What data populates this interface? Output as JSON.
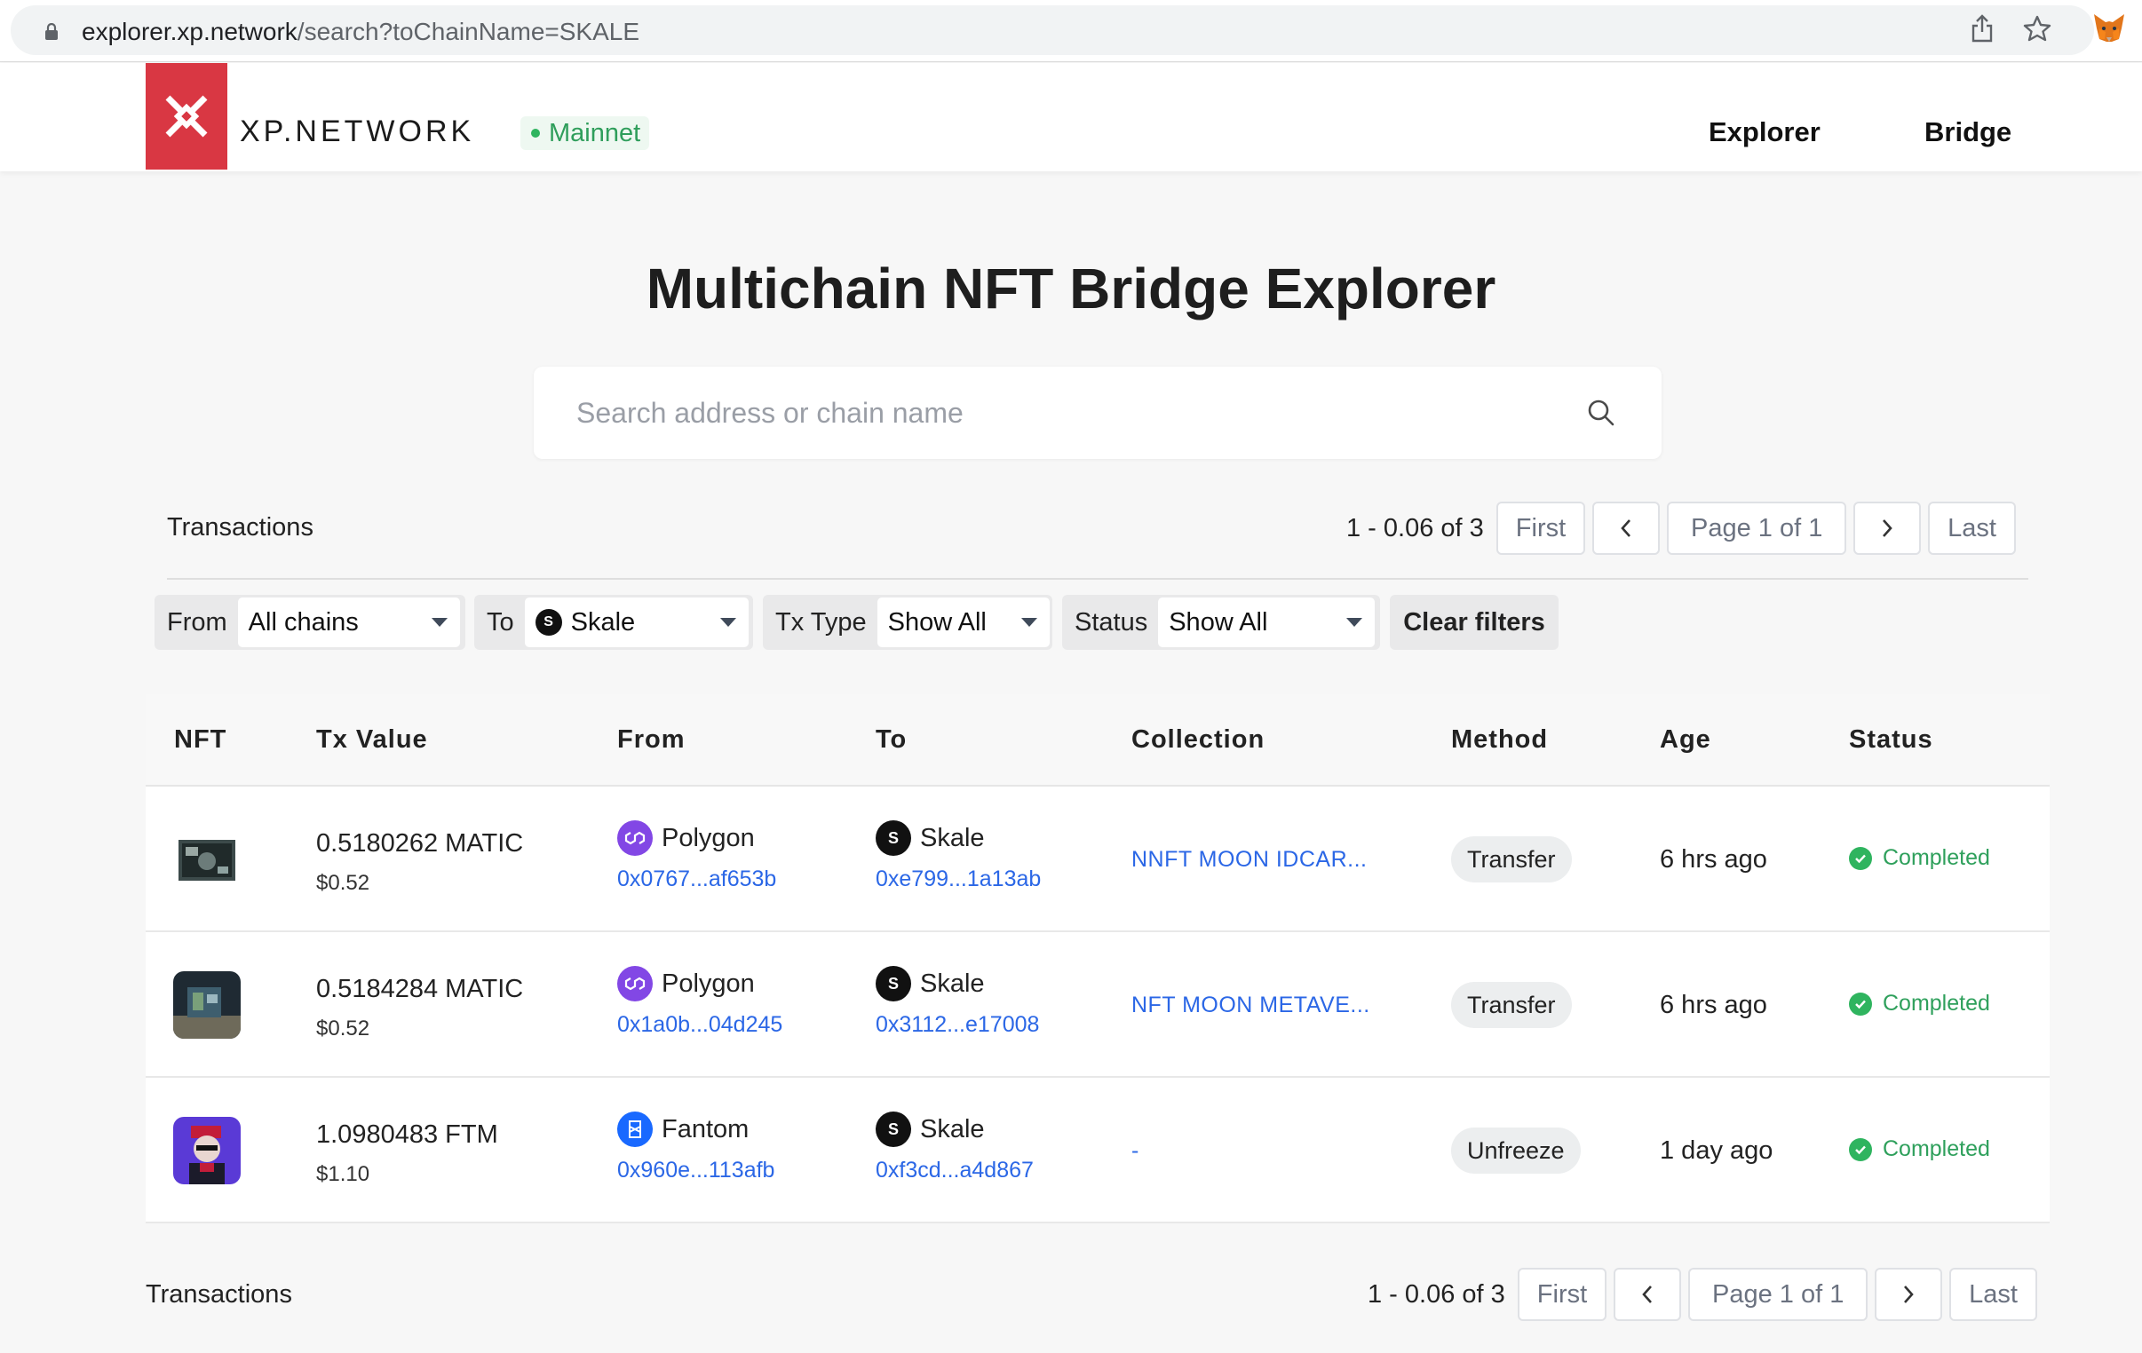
{
  "browser": {
    "url_host": "explorer.xp.network",
    "url_path": "/search?toChainName=SKALE"
  },
  "header": {
    "brand": "XP.NETWORK",
    "network_badge": "Mainnet",
    "nav": {
      "explorer": "Explorer",
      "bridge": "Bridge"
    }
  },
  "page": {
    "title": "Multichain NFT Bridge Explorer",
    "search_placeholder": "Search address or chain name"
  },
  "pagination_top": {
    "label": "Transactions",
    "range": "1 - 0.06 of 3",
    "first": "First",
    "page": "Page 1 of 1",
    "last": "Last"
  },
  "pagination_bottom": {
    "label": "Transactions",
    "range": "1 - 0.06 of 3",
    "first": "First",
    "page": "Page 1 of 1",
    "last": "Last"
  },
  "filters": {
    "from_label": "From",
    "from_value": "All chains",
    "to_label": "To",
    "to_value": "Skale",
    "txtype_label": "Tx Type",
    "txtype_value": "Show All",
    "status_label": "Status",
    "status_value": "Show All",
    "clear": "Clear filters"
  },
  "table": {
    "headers": {
      "nft": "NFT",
      "tx_value": "Tx Value",
      "from": "From",
      "to": "To",
      "collection": "Collection",
      "method": "Method",
      "age": "Age",
      "status": "Status"
    },
    "rows": [
      {
        "value": "0.5180262 MATIC",
        "usd": "$0.52",
        "from_chain": "Polygon",
        "from_addr": "0x0767...af653b",
        "to_chain": "Skale",
        "to_addr": "0xe799...1a13ab",
        "collection": "NNFT MOON IDCAR...",
        "method": "Transfer",
        "age": "6 hrs ago",
        "status": "Completed"
      },
      {
        "value": "0.5184284 MATIC",
        "usd": "$0.52",
        "from_chain": "Polygon",
        "from_addr": "0x1a0b...04d245",
        "to_chain": "Skale",
        "to_addr": "0x3112...e17008",
        "collection": "NFT MOON METAVE...",
        "method": "Transfer",
        "age": "6 hrs ago",
        "status": "Completed"
      },
      {
        "value": "1.0980483 FTM",
        "usd": "$1.10",
        "from_chain": "Fantom",
        "from_addr": "0x960e...113afb",
        "to_chain": "Skale",
        "to_addr": "0xf3cd...a4d867",
        "collection": "-",
        "method": "Unfreeze",
        "age": "1 day ago",
        "status": "Completed"
      }
    ]
  },
  "colors": {
    "brand": "#d93743",
    "link": "#2b67e6",
    "success": "#2fb45f",
    "polygon": "#8247e5",
    "fantom": "#1969ff",
    "skale": "#111111"
  },
  "icons": {
    "lock": "lock-icon",
    "share": "share-icon",
    "star": "star-icon",
    "metamask": "metamask-fox-icon",
    "search": "search-icon",
    "check": "check-circle-icon"
  }
}
